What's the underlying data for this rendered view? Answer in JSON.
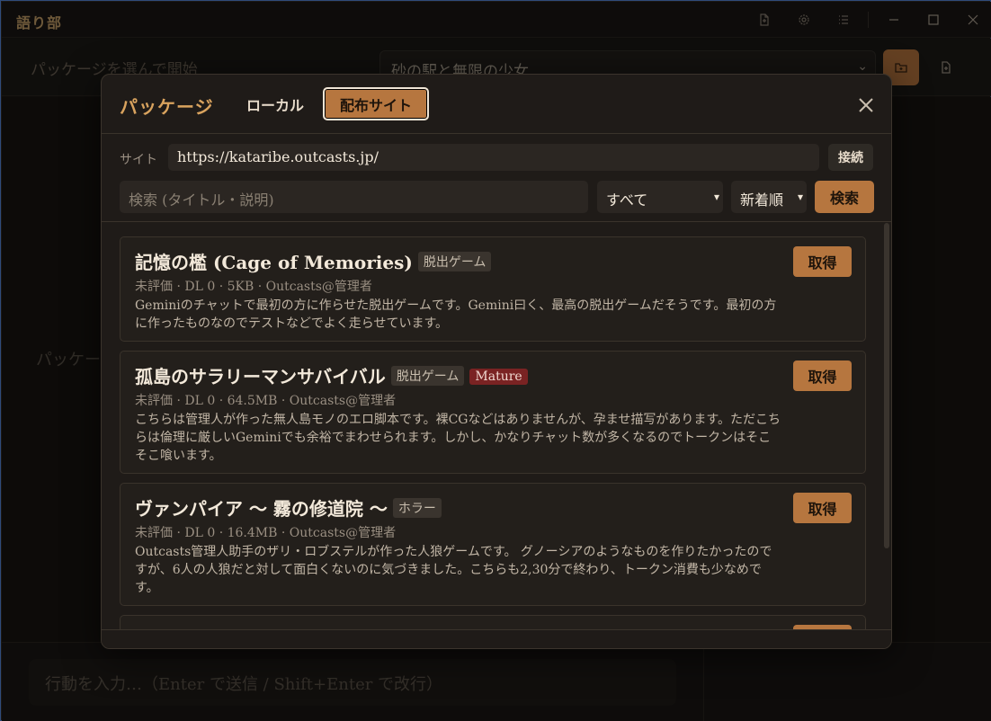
{
  "window": {
    "title": "語り部",
    "toolbar_icons": [
      "document-icon",
      "gear-icon",
      "list-icon"
    ],
    "controls": [
      "minimize-icon",
      "maximize-icon",
      "close-icon"
    ]
  },
  "background": {
    "package_hint": "パッケージを選んで開始",
    "selected_package": "砂の駅と無限の少女",
    "main_hint": "パッケー",
    "input_placeholder": "行動を入力…（Enter で送信 / Shift+Enter で改行）"
  },
  "modal": {
    "title": "パッケージ",
    "tabs": {
      "local": "ローカル",
      "site": "配布サイト"
    },
    "site_label": "サイト",
    "site_url": "https://kataribe.outcasts.jp/",
    "connect_label": "接続",
    "search_placeholder": "検索 (タイトル・説明)",
    "category_filter": "すべて",
    "sort_order": "新着順",
    "search_label": "検索",
    "get_label": "取得",
    "packages": [
      {
        "title": "記憶の檻 (Cage of Memories)",
        "tags": [
          "脱出ゲーム"
        ],
        "rating": "未評価",
        "downloads": "DL 0",
        "size": "5KB",
        "author": "Outcasts@管理者",
        "description": "Geminiのチャットで最初の方に作らせた脱出ゲームです。Gemini曰く、最高の脱出ゲームだそうです。最初の方に作ったものなのでテストなどでよく走らせています。"
      },
      {
        "title": "孤島のサラリーマンサバイバル",
        "tags": [
          "脱出ゲーム"
        ],
        "mature_tag": "Mature",
        "rating": "未評価",
        "downloads": "DL 0",
        "size": "64.5MB",
        "author": "Outcasts@管理者",
        "description": "こちらは管理人が作った無人島モノのエロ脚本です。裸CGなどはありませんが、孕ませ描写があります。ただこちらは倫理に厳しいGeminiでも余裕でまわせられます。しかし、かなりチャット数が多くなるのでトークンはそこそこ喰います。"
      },
      {
        "title": "ヴァンパイア 〜 霧の修道院 〜",
        "tags": [
          "ホラー"
        ],
        "rating": "未評価",
        "downloads": "DL 0",
        "size": "16.4MB",
        "author": "Outcasts@管理者",
        "description": "Outcasts管理人助手のザリ・ロブステルが作った人狼ゲームです。 グノーシアのようなものを作りたかったのですが、6人の人狼だと対して面白くないのに気づきました。こちらも2,30分で終わり、トークン消費も少なめです。"
      }
    ],
    "colors": {
      "accent": "#b6763f",
      "title": "#d9a35e",
      "mature": "#7a2323"
    }
  }
}
